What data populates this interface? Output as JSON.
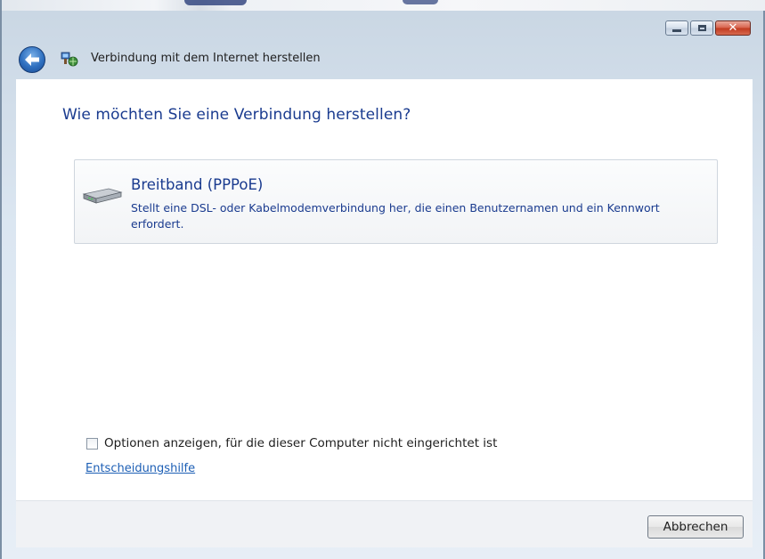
{
  "window": {
    "title": "Verbindung mit dem Internet herstellen"
  },
  "header": {
    "back_icon": "back-arrow-icon",
    "app_icon": "network-connection-icon"
  },
  "caption_buttons": {
    "minimize_icon": "minimize-icon",
    "maximize_icon": "maximize-icon",
    "close_icon": "close-icon"
  },
  "main": {
    "heading": "Wie möchten Sie eine Verbindung herstellen?",
    "options": [
      {
        "icon": "modem-icon",
        "title": "Breitband (PPPoE)",
        "description": "Stellt eine DSL- oder Kabelmodemverbindung her, die einen Benutzernamen und ein Kennwort erfordert."
      }
    ],
    "show_options_checkbox": {
      "label": "Optionen anzeigen, für die dieser Computer nicht eingerichtet ist",
      "checked": false
    },
    "help_link": "Entscheidungshilfe"
  },
  "footer": {
    "cancel_label": "Abbrechen"
  },
  "colors": {
    "heading": "#1a3b8f",
    "link": "#1d5fb5",
    "close_button": "#c0391f"
  }
}
